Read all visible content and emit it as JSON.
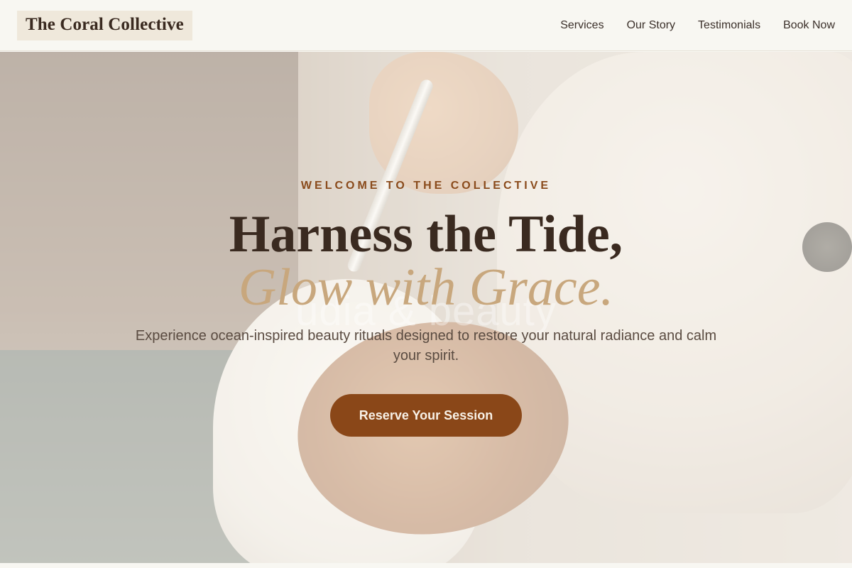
{
  "brand": {
    "name": "The Coral Collective"
  },
  "nav": {
    "items": [
      {
        "label": "Services"
      },
      {
        "label": "Our Story"
      },
      {
        "label": "Testimonials"
      },
      {
        "label": "Book Now"
      }
    ]
  },
  "hero": {
    "eyebrow": "WELCOME TO THE COLLECTIVE",
    "title_line1": "Harness the Tide,",
    "title_line2": "Glow with Grace.",
    "ghost_text": "udia & beauty",
    "subtitle": "Experience ocean-inspired beauty rituals designed to restore your natural radiance and calm your spirit.",
    "cta_label": "Reserve Your Session"
  },
  "colors": {
    "accent": "#8a4718",
    "eyebrow": "#8a4b1c",
    "gold": "#c8a77d",
    "text_dark": "#3a2a20",
    "background": "#f8f7f2"
  }
}
